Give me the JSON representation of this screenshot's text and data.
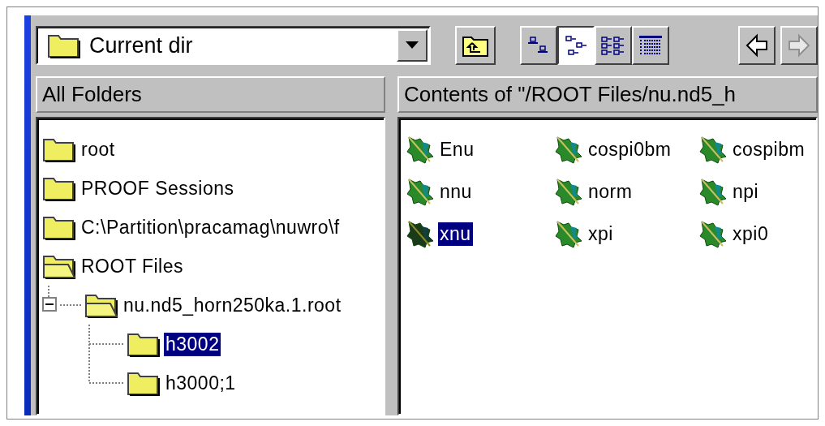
{
  "location": {
    "value": "Current dir"
  },
  "view_buttons": [
    {
      "kind": "large",
      "selected": false
    },
    {
      "kind": "small",
      "selected": true
    },
    {
      "kind": "list",
      "selected": false
    },
    {
      "kind": "details",
      "selected": false
    }
  ],
  "nav_buttons": [
    {
      "kind": "back",
      "disabled": false
    },
    {
      "kind": "forward",
      "disabled": true
    }
  ],
  "tree": {
    "header": "All Folders",
    "items": [
      {
        "label": "root",
        "expanded": false,
        "selected": false
      },
      {
        "label": "PROOF Sessions",
        "expanded": false,
        "selected": false
      },
      {
        "label": "C:\\Partition\\pracamag\\nuwro\\f",
        "expanded": false,
        "selected": false
      },
      {
        "label": "ROOT Files",
        "expanded": true,
        "selected": false,
        "children": [
          {
            "label": "nu.nd5_horn250ka.1.root",
            "expanded": true,
            "selected": false,
            "children": [
              {
                "label": "h3002",
                "expanded": false,
                "selected": true
              },
              {
                "label": "h3000;1",
                "expanded": false,
                "selected": false
              }
            ]
          }
        ]
      }
    ]
  },
  "contents": {
    "header": "Contents of \"/ROOT Files/nu.nd5_h",
    "items": [
      {
        "label": "Enu",
        "selected": false
      },
      {
        "label": "cospi0bm",
        "selected": false
      },
      {
        "label": "cospibm",
        "selected": false
      },
      {
        "label": "nnu",
        "selected": false
      },
      {
        "label": "norm",
        "selected": false
      },
      {
        "label": "npi",
        "selected": false
      },
      {
        "label": "xnu",
        "selected": true
      },
      {
        "label": "xpi",
        "selected": false
      },
      {
        "label": "xpi0",
        "selected": false
      }
    ]
  }
}
